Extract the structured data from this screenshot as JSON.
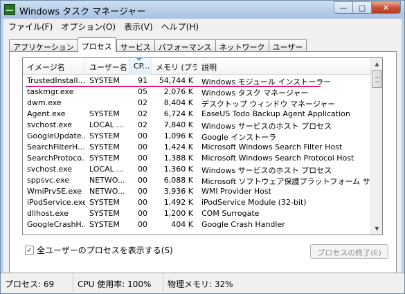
{
  "window": {
    "title": "Windows タスク マネージャー"
  },
  "caption": {
    "minimize": "—",
    "maximize": "□",
    "close": "✕"
  },
  "menu": [
    "ファイル(F)",
    "オプション(O)",
    "表示(V)",
    "ヘルプ(H)"
  ],
  "tabs": [
    "アプリケーション",
    "プロセス",
    "サービス",
    "パフォーマンス",
    "ネットワーク",
    "ユーザー"
  ],
  "active_tab": "プロセス",
  "columns": [
    "イメージ名",
    "ユーザー名",
    "CP...",
    "メモリ (プラ...",
    "説明"
  ],
  "sorted_column": "CP...",
  "rows": [
    [
      "TrustedInstall...",
      "SYSTEM",
      "91",
      "54,744 K",
      "Windows モジュール インストーラー"
    ],
    [
      "taskmgr.exe",
      "",
      "05",
      "2,076 K",
      "Windows タスク マネージャー"
    ],
    [
      "dwm.exe",
      "",
      "02",
      "8,404 K",
      "デスクトップ ウィンドウ マネージャー"
    ],
    [
      "Agent.exe",
      "SYSTEM",
      "02",
      "6,724 K",
      "EaseUS Todo Backup Agent Application"
    ],
    [
      "svchost.exe",
      "LOCAL ...",
      "02",
      "7,840 K",
      "Windows サービスのホスト プロセス"
    ],
    [
      "GoogleUpdate....",
      "SYSTEM",
      "00",
      "1,096 K",
      "Google インストーラ"
    ],
    [
      "SearchFilterH...",
      "SYSTEM",
      "00",
      "1,424 K",
      "Microsoft Windows Search Filter Host"
    ],
    [
      "SearchProtoco...",
      "SYSTEM",
      "00",
      "1,388 K",
      "Microsoft Windows Search Protocol Host"
    ],
    [
      "svchost.exe",
      "LOCAL ...",
      "00",
      "1,360 K",
      "Windows サービスのホスト プロセス"
    ],
    [
      "sppsvc.exe",
      "NETWO...",
      "00",
      "6,088 K",
      "Microsoft ソフトウェア保護プラットフォーム サ..."
    ],
    [
      "WmiPrvSE.exe",
      "NETWO...",
      "00",
      "3,936 K",
      "WMI Provider Host"
    ],
    [
      "iPodService.exe",
      "SYSTEM",
      "00",
      "1,492 K",
      "iPodService Module (32-bit)"
    ],
    [
      "dllhost.exe",
      "SYSTEM",
      "00",
      "1,200 K",
      "COM Surrogate"
    ],
    [
      "GoogleCrashH...",
      "SYSTEM",
      "00",
      "404 K",
      "Google Crash Handler"
    ]
  ],
  "scrollbar": {
    "up": "▲",
    "down": "▼"
  },
  "show_all_users": {
    "label": "全ユーザーのプロセスを表示する(S)",
    "checked": true,
    "mark": "✓"
  },
  "end_process_label": "プロセスの終了(E)",
  "status": [
    "プロセス: 69",
    "CPU 使用率: 100%",
    "物理メモリ: 32%"
  ],
  "colors": {
    "highlight_underline": "#e0147a",
    "title_gradient": "#b6cde8"
  }
}
